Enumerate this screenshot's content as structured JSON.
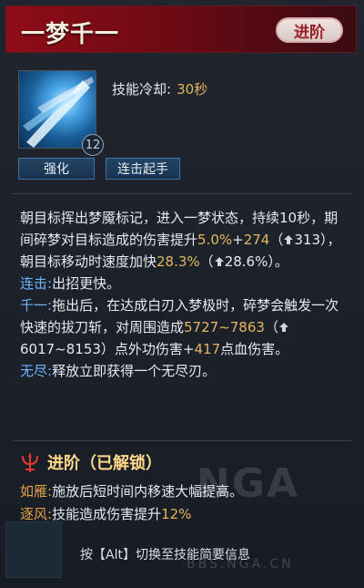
{
  "header": {
    "title": "一梦千一",
    "upgrade_label": "进阶"
  },
  "skill": {
    "level": "12",
    "cooldown_label": "技能冷却:",
    "cooldown_value": "30秒",
    "buttons": {
      "enhance": "强化",
      "combo_start": "连击起手"
    }
  },
  "description": {
    "p1": {
      "t1": "朝目标挥出梦魇标记，进入一梦状态，持续10秒，期间碎梦对目标造成的伤害提升",
      "v1": "5.0%",
      "t2": "+",
      "v2": "274",
      "t3": "（",
      "v3": "313",
      "t4": "），朝目标移动时速度加快",
      "v4": "28.3%",
      "t5": "（",
      "v5": "28.6%",
      "t6": "）。"
    },
    "p2": {
      "label": "连击:",
      "text": "出招更快。"
    },
    "p3": {
      "label": "千一:",
      "t1": "拖出后，在达成白刃入梦极时，碎梦会触发一次快速的拔刀斩，对周围造成",
      "v1": "5727~7863",
      "t2": "（",
      "v2": "6017~8153",
      "t3": "）点外功伤害+",
      "v3": "417",
      "t4": "点血伤害。"
    },
    "p4": {
      "label": "无尽:",
      "text": "释放立即获得一个无尽刃。"
    }
  },
  "advance": {
    "title": "进阶（已解锁）",
    "items": [
      {
        "label": "如雁:",
        "text": "施放后短时间内移速大幅提高。"
      },
      {
        "label": "逐风:",
        "text": "技能造成伤害提升",
        "value": "12%"
      }
    ]
  },
  "hint": "按【Alt】切换至技能简要信息",
  "watermark": {
    "text": "NGA",
    "url": "BBS.NGA.CN"
  },
  "colors": {
    "header_red": "#8e0d18",
    "highlight_gold": "#e3b760",
    "label_blue": "#6fb4ff",
    "label_orange": "#e1a24a"
  }
}
